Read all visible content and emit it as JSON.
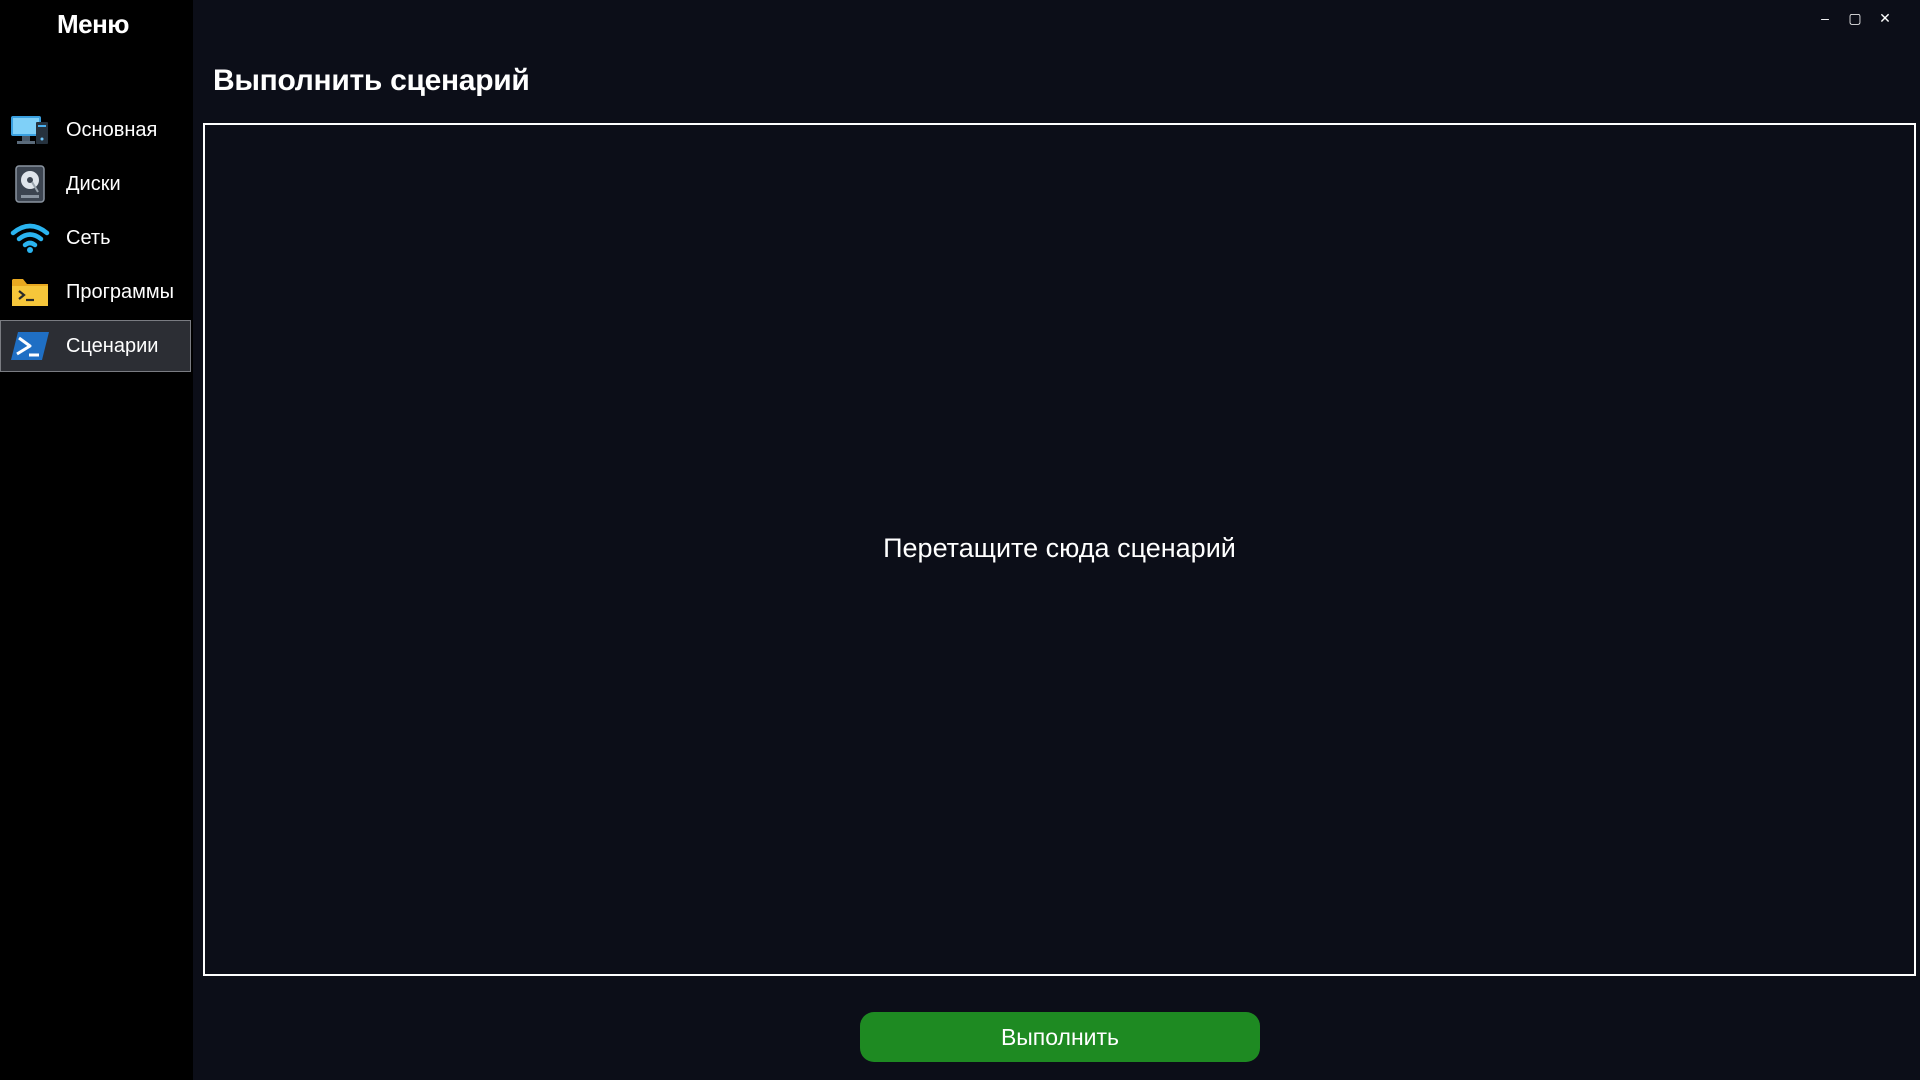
{
  "sidebar": {
    "title": "Меню",
    "items": [
      {
        "label": "Основная",
        "icon": "monitor-icon",
        "active": false
      },
      {
        "label": "Диски",
        "icon": "hard-drive-icon",
        "active": false
      },
      {
        "label": "Сеть",
        "icon": "wifi-icon",
        "active": false
      },
      {
        "label": "Программы",
        "icon": "folder-terminal-icon",
        "active": false
      },
      {
        "label": "Сценарии",
        "icon": "powershell-icon",
        "active": true
      }
    ]
  },
  "window_controls": {
    "minimize": "–",
    "maximize": "▢",
    "close": "✕"
  },
  "main": {
    "title": "Выполнить сценарий",
    "drop_zone_text": "Перетащите сюда сценарий",
    "run_button_label": "Выполнить"
  },
  "colors": {
    "background": "#0c0e18",
    "sidebar": "#000000",
    "active_item": "#2c2e34",
    "run_button": "#1e8a22",
    "drop_zone_border": "#ffffff"
  }
}
